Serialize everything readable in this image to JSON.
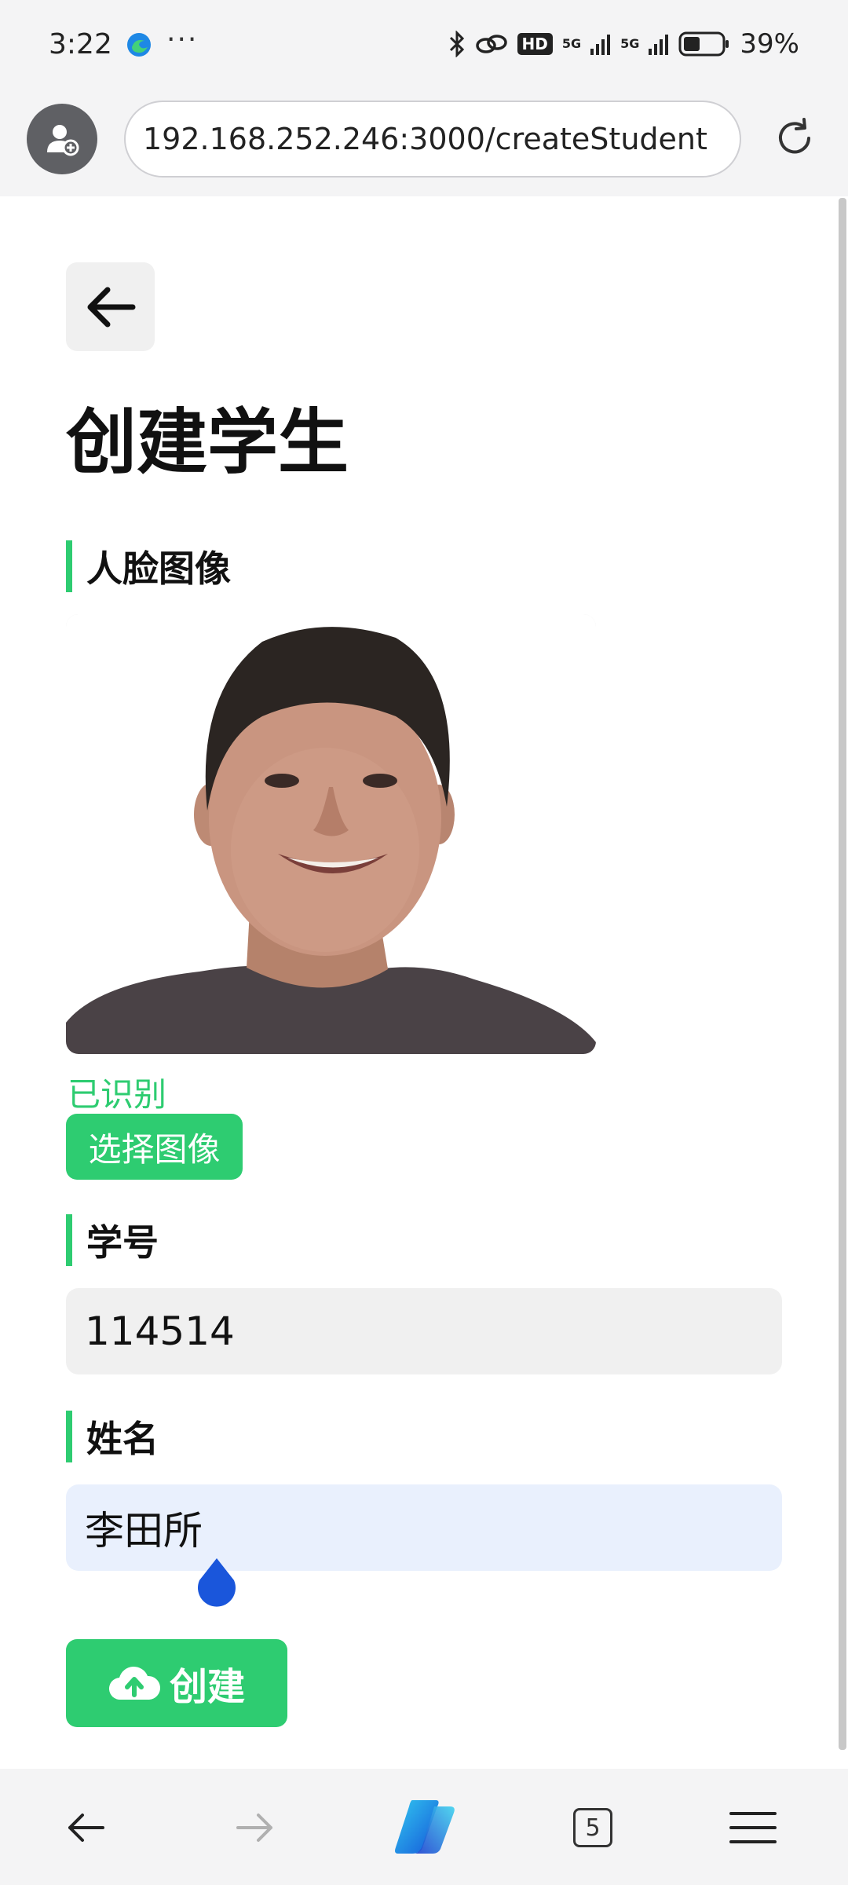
{
  "status_bar": {
    "time": "3:22",
    "dots": "···",
    "hd_label": "HD",
    "signal_1": "5G",
    "signal_2": "5G",
    "battery": "39%",
    "icons": [
      "edge-icon",
      "bluetooth-icon",
      "link-icon",
      "battery-icon"
    ]
  },
  "browser": {
    "url": "192.168.252.246:3000/createStudent",
    "tabs_count": "5"
  },
  "page": {
    "title": "创建学生",
    "face_section_label": "人脸图像",
    "recognized_text": "已识别",
    "select_image_label": "选择图像",
    "student_id_label": "学号",
    "student_id_value": "114514",
    "name_label": "姓名",
    "name_value": "李田所",
    "create_button_label": "创建"
  },
  "colors": {
    "accent_green": "#2ecc71",
    "name_field_bg": "#e9f0fd",
    "cursor_handle": "#1a56db"
  }
}
